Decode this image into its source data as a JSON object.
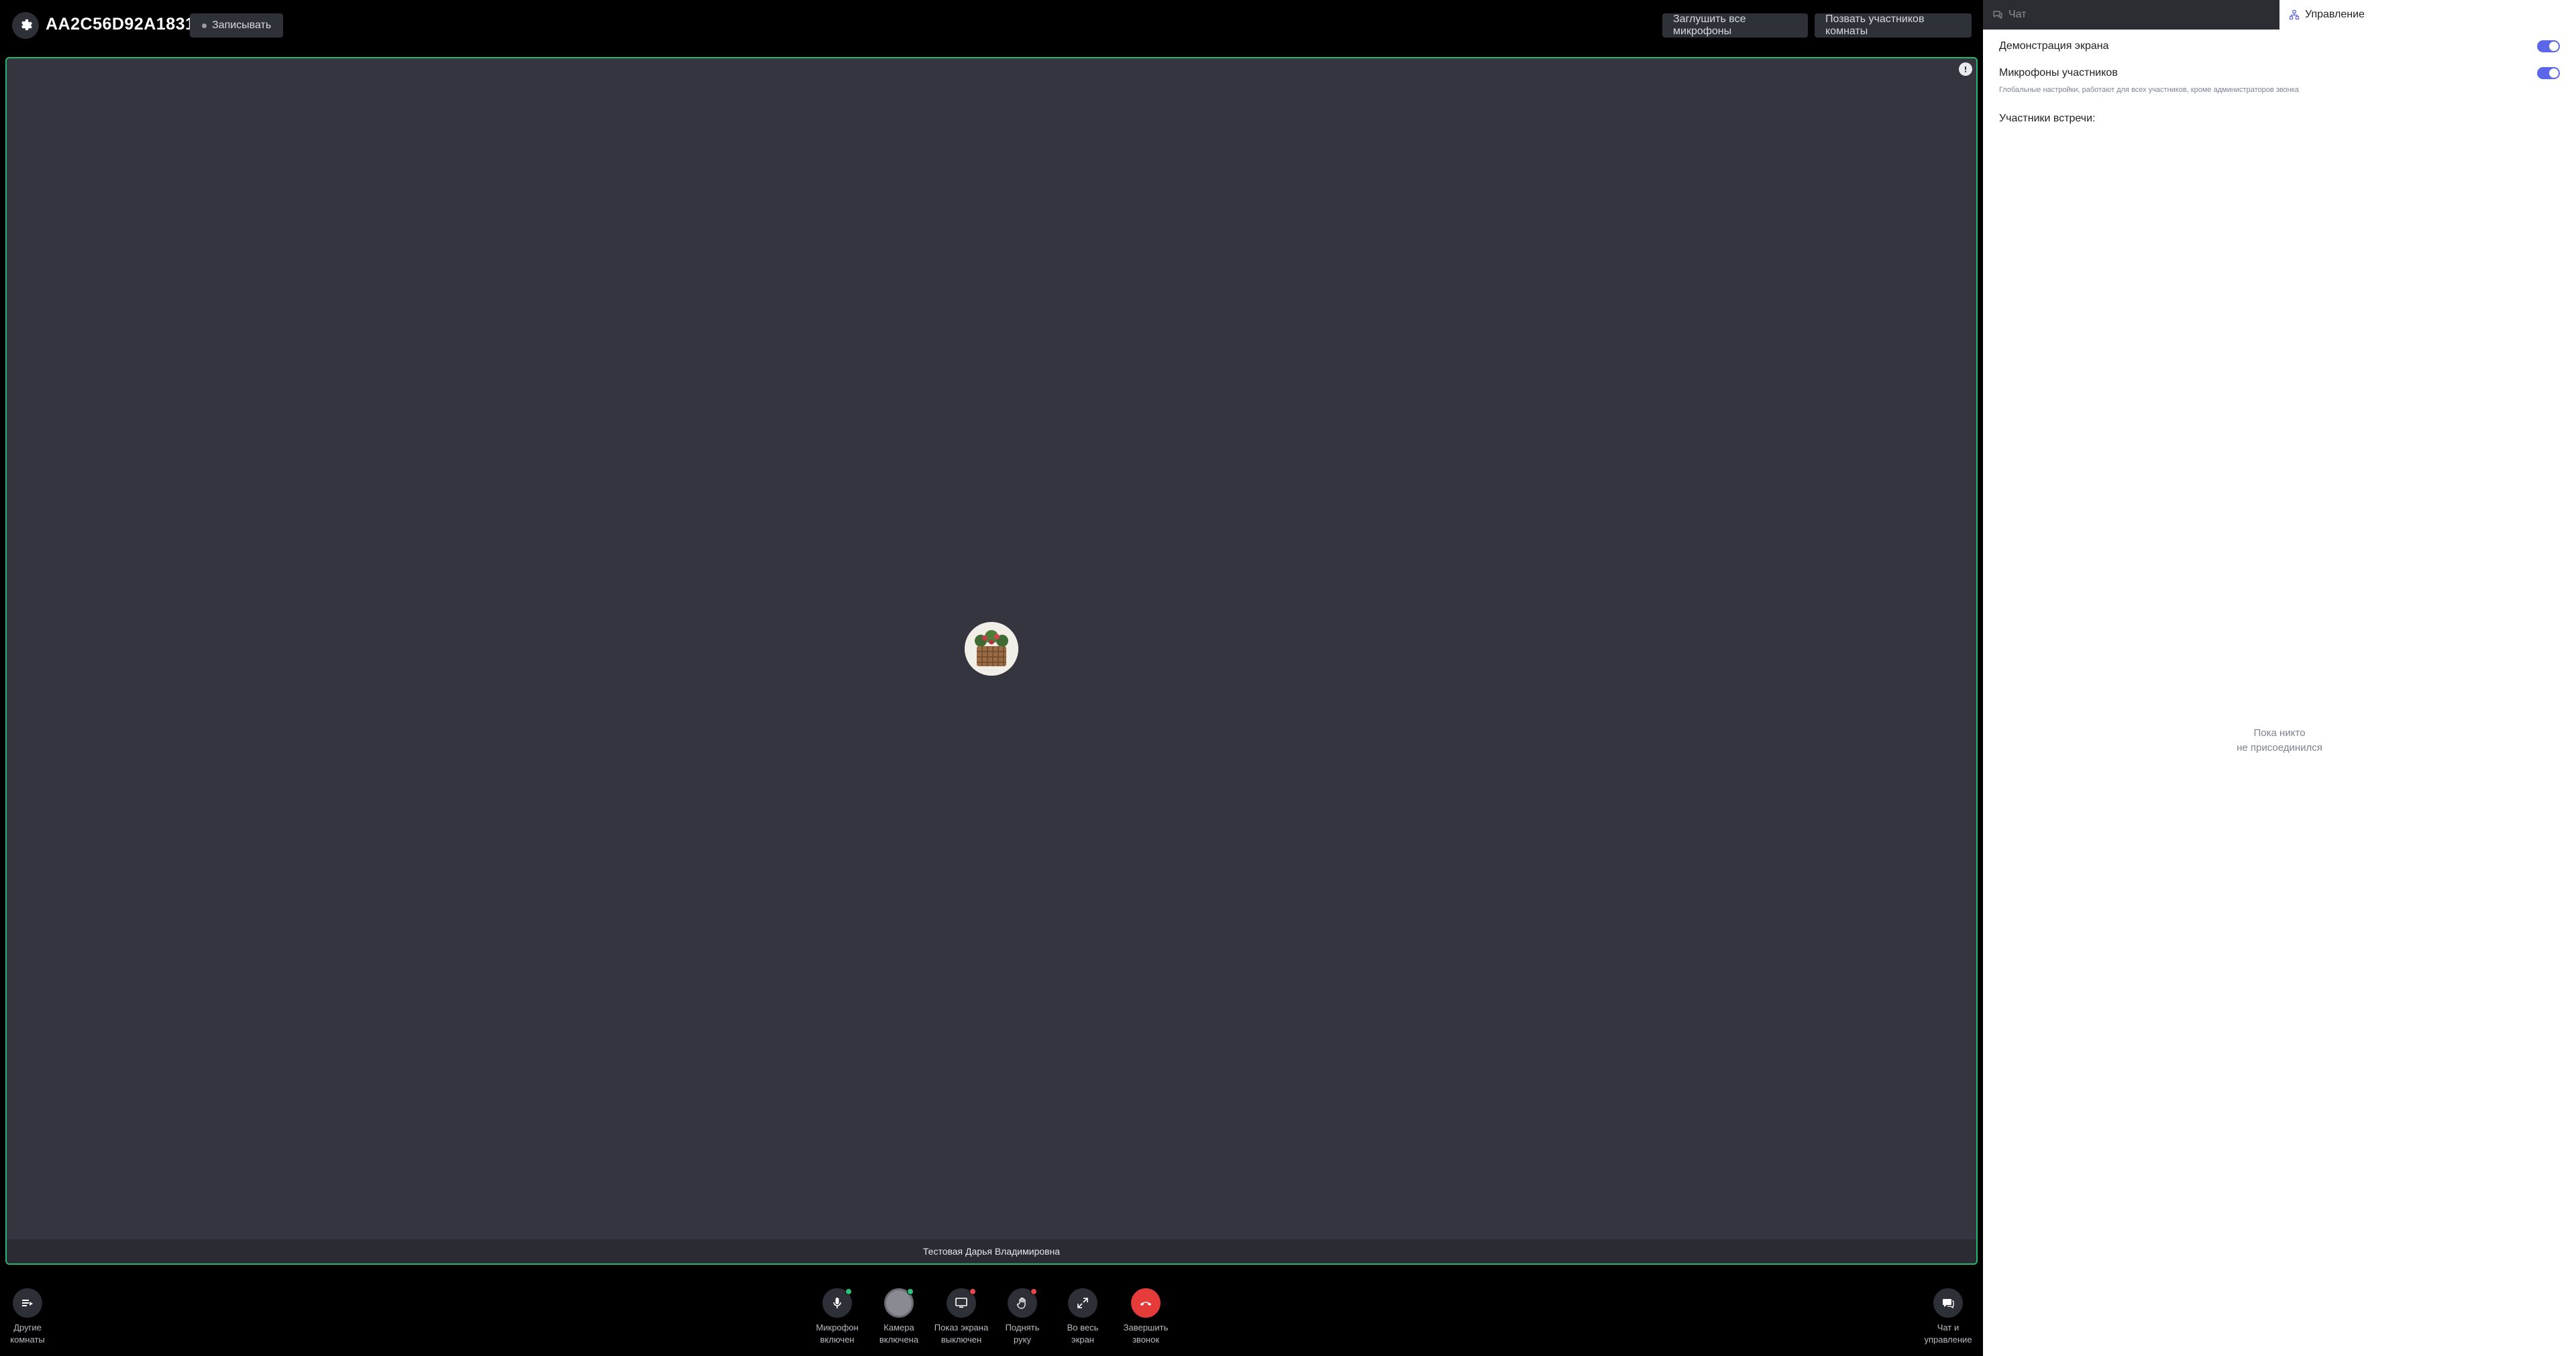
{
  "header": {
    "room_id": "AA2C56D92A1831B",
    "record_label": "Записывать",
    "mute_all_label": "Заглушить все микрофоны",
    "invite_label": "Позвать участников комнаты"
  },
  "video": {
    "participant_name": "Тестовая Дарья Владимировна"
  },
  "controls": {
    "other_rooms": "Другие\nкомнаты",
    "mic": "Микрофон\nвключен",
    "camera": "Камера\nвключена",
    "screen": "Показ экрана\nвыключен",
    "hand": "Поднять\nруку",
    "fullscreen": "Во весь\nэкран",
    "end_call": "Завершить\nзвонок",
    "chat_manage": "Чат и\nуправление"
  },
  "panel": {
    "tab_chat": "Чат",
    "tab_manage": "Управление",
    "screen_share_label": "Демонстрация экрана",
    "mics_label": "Микрофоны участников",
    "mics_hint": "Глобальные настройки, работают для всех участников, кроме администраторов звонка",
    "participants_title": "Участники встречи:",
    "empty_line1": "Пока никто",
    "empty_line2": "не присоединился"
  },
  "colors": {
    "accent_green": "#22b86d",
    "toggle_blue": "#5b67e8",
    "end_red": "#e53b3b"
  }
}
